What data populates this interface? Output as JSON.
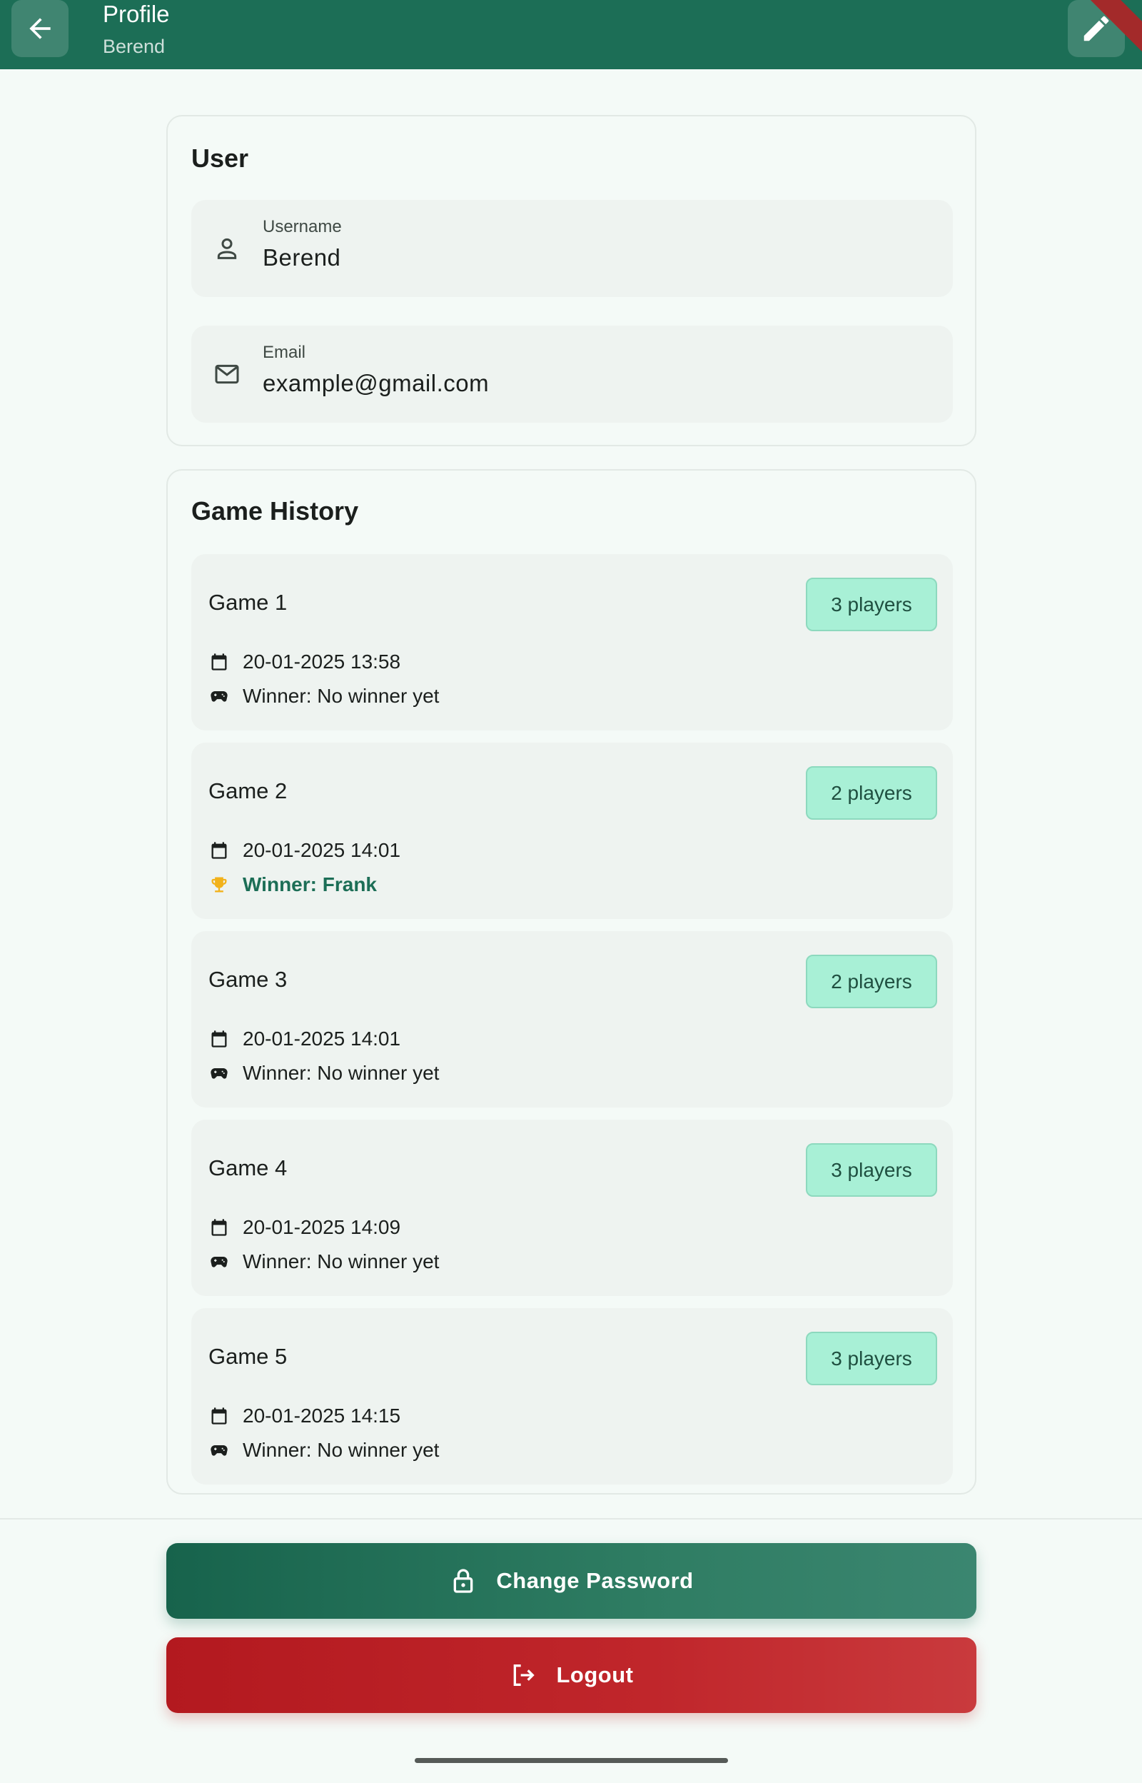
{
  "appbar": {
    "title": "Profile",
    "subtitle": "Berend",
    "back_icon": "arrow-left-icon",
    "edit_icon": "pencil-icon"
  },
  "user_card": {
    "title": "User",
    "username": {
      "label": "Username",
      "value": "Berend",
      "icon": "person-icon"
    },
    "email": {
      "label": "Email",
      "value": "example@gmail.com",
      "icon": "mail-icon"
    }
  },
  "history_card": {
    "title": "Game History",
    "games": [
      {
        "name": "Game 1",
        "players": "3 players",
        "date": "20-01-2025 13:58",
        "winner": "Winner: No winner yet",
        "winner_icon": "gamepad-icon"
      },
      {
        "name": "Game 2",
        "players": "2 players",
        "date": "20-01-2025 14:01",
        "winner": "Winner: Frank",
        "winner_icon": "trophy-icon"
      },
      {
        "name": "Game 3",
        "players": "2 players",
        "date": "20-01-2025 14:01",
        "winner": "Winner: No winner yet",
        "winner_icon": "gamepad-icon"
      },
      {
        "name": "Game 4",
        "players": "3 players",
        "date": "20-01-2025 14:09",
        "winner": "Winner: No winner yet",
        "winner_icon": "gamepad-icon"
      },
      {
        "name": "Game 5",
        "players": "3 players",
        "date": "20-01-2025 14:15",
        "winner": "Winner: No winner yet",
        "winner_icon": "gamepad-icon"
      }
    ]
  },
  "actions": {
    "change_password": "Change Password",
    "logout": "Logout"
  },
  "colors": {
    "primary": "#1c6e56",
    "badge": "#a8f0d6",
    "danger": "#c0262b",
    "trophy": "#f2b21b"
  }
}
